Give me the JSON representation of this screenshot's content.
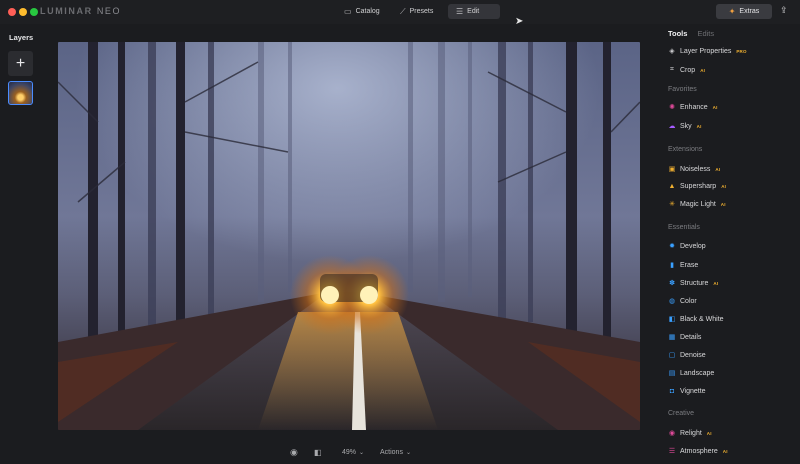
{
  "app": {
    "logo_main": "LUMINAR",
    "logo_neo": "NEO",
    "colors": {
      "close": "#ff5f57",
      "minimize": "#febc2e",
      "zoom": "#28c840",
      "accent": "#4a8cff",
      "badge": "#f0b030"
    }
  },
  "topnav": {
    "catalog": {
      "label": "Catalog",
      "icon": "folder-icon"
    },
    "presets": {
      "label": "Presets",
      "icon": "wand-icon"
    },
    "edit": {
      "label": "Edit",
      "icon": "sliders-icon"
    },
    "extras": {
      "label": "Extras",
      "icon": "puzzle-icon"
    },
    "share_icon": "share-icon"
  },
  "layers": {
    "title": "Layers",
    "add_icon": "plus-icon"
  },
  "bottombar": {
    "zoom": "49%",
    "actions": "Actions",
    "icons": [
      "eye-icon",
      "compare-icon",
      "chevron-down-icon"
    ]
  },
  "tools": {
    "tab_tools": "Tools",
    "tab_edits": "Edits",
    "items": {
      "layer_properties": {
        "label": "Layer Properties",
        "badge": "PRO",
        "icon": "layers-icon"
      },
      "crop": {
        "label": "Crop",
        "badge": "AI",
        "icon": "crop-icon"
      },
      "favorites": "Favorites",
      "enhance": {
        "label": "Enhance",
        "badge": "AI",
        "icon": "enhance-icon"
      },
      "sky": {
        "label": "Sky",
        "badge": "AI",
        "icon": "cloud-icon"
      },
      "extensions": "Extensions",
      "noiseless": {
        "label": "Noiseless",
        "badge": "AI",
        "icon": "noiseless-icon"
      },
      "supersharp": {
        "label": "Supersharp",
        "badge": "AI",
        "icon": "triangle-icon"
      },
      "magic_light": {
        "label": "Magic Light",
        "badge": "AI",
        "icon": "magic-light-icon"
      },
      "essentials": "Essentials",
      "develop": {
        "label": "Develop",
        "icon": "develop-icon"
      },
      "erase": {
        "label": "Erase",
        "icon": "erase-icon"
      },
      "structure": {
        "label": "Structure",
        "badge": "AI",
        "icon": "structure-icon"
      },
      "color": {
        "label": "Color",
        "icon": "color-icon"
      },
      "black_white": {
        "label": "Black & White",
        "icon": "bw-icon"
      },
      "details": {
        "label": "Details",
        "icon": "details-icon"
      },
      "denoise": {
        "label": "Denoise",
        "icon": "denoise-icon"
      },
      "landscape": {
        "label": "Landscape",
        "icon": "landscape-icon"
      },
      "vignette": {
        "label": "Vignette",
        "icon": "vignette-icon"
      },
      "creative": "Creative",
      "relight": {
        "label": "Relight",
        "badge": "AI",
        "icon": "relight-icon"
      },
      "atmosphere": {
        "label": "Atmosphere",
        "badge": "AI",
        "icon": "atmosphere-icon"
      }
    }
  }
}
